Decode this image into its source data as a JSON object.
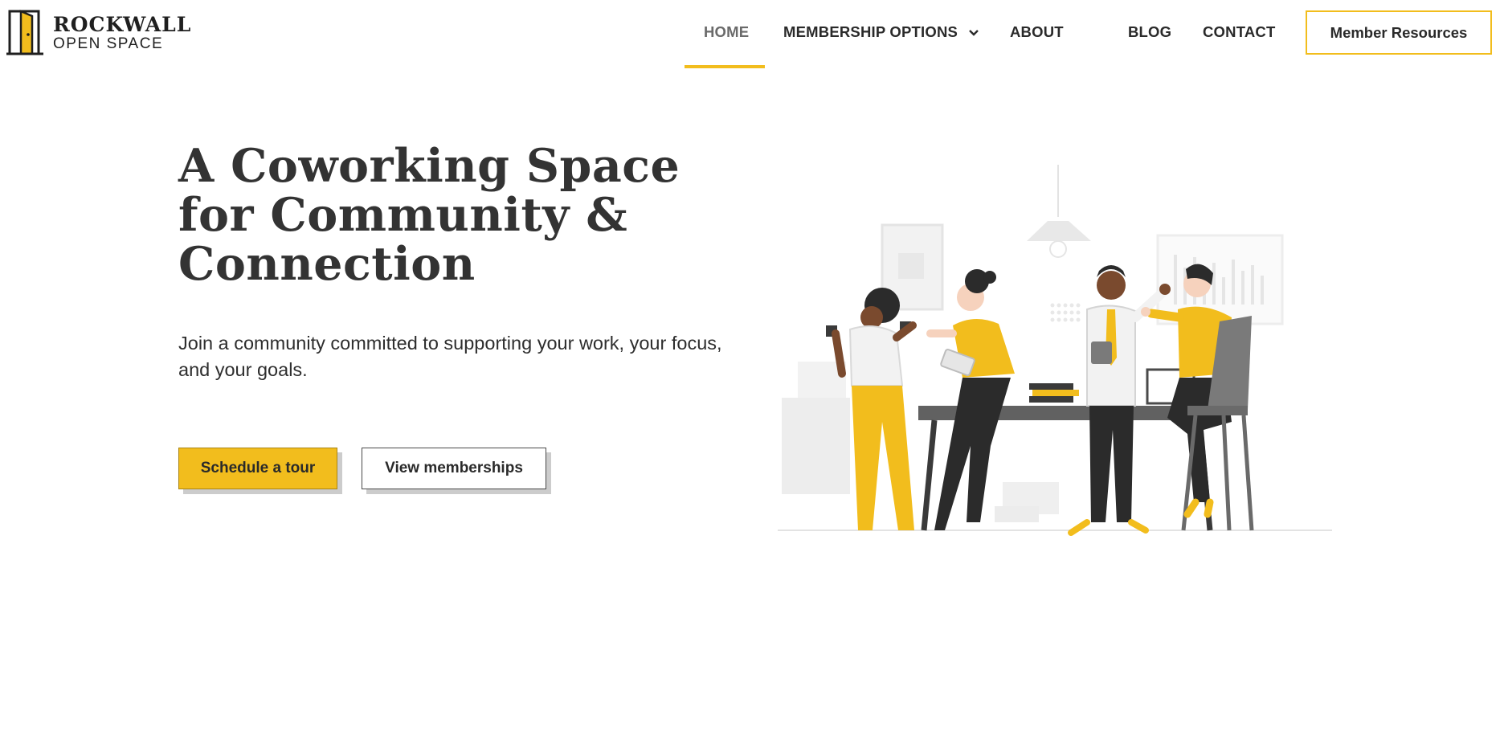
{
  "brand": {
    "title": "ROCKWALL",
    "subtitle": "OPEN SPACE"
  },
  "nav": {
    "items": [
      {
        "label": "HOME",
        "active": true
      },
      {
        "label": "MEMBERSHIP OPTIONS",
        "has_dropdown": true
      },
      {
        "label": "ABOUT"
      },
      {
        "label": "BLOG"
      },
      {
        "label": "CONTACT"
      }
    ],
    "cta_label": "Member Resources"
  },
  "hero": {
    "title": "A Coworking Space for Community & Connection",
    "subtitle": "Join a community committed to supporting your work, your focus, and your goals.",
    "primary_button": "Schedule a tour",
    "secondary_button": "View memberships"
  },
  "colors": {
    "accent": "#f2bd1d",
    "text": "#2f2f2f",
    "dark_gray": "#333333"
  },
  "icons": {
    "logo": "door-icon",
    "dropdown": "chevron-down-icon"
  }
}
